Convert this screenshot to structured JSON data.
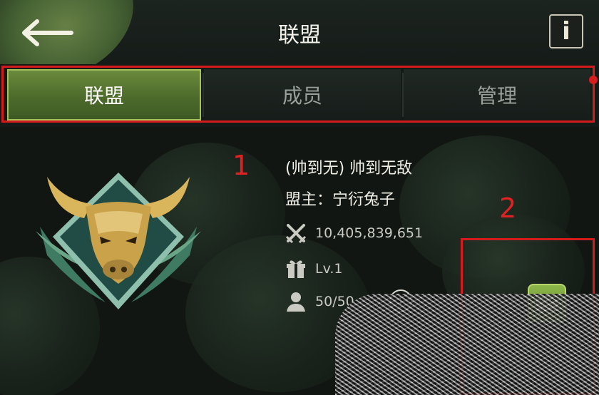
{
  "header": {
    "title": "联盟",
    "back_icon": "arrow-left-icon",
    "info_label": "i"
  },
  "tabs": [
    {
      "label": "联盟",
      "active": true
    },
    {
      "label": "成员",
      "active": false
    },
    {
      "label": "管理",
      "active": false
    }
  ],
  "annotations": {
    "one": "1",
    "two": "2"
  },
  "alliance": {
    "name": "(帅到无) 帅到无敌",
    "leader": "盟主：宁衍兔子",
    "power": "10,405,839,651",
    "level": "Lv.1",
    "members": "50/50",
    "info_label": "i"
  },
  "colors": {
    "accent_green": "#5e8a2c",
    "annotation_red": "#d51b1b",
    "emblem_gold": "#c9a24a",
    "emblem_teal": "#2b5a52"
  }
}
